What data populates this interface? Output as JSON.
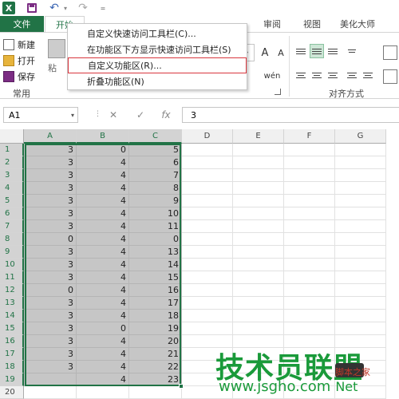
{
  "quick_access": {
    "app_icon": "X",
    "undo_glyph": "↶",
    "redo_glyph": "↷",
    "dropdown_glyph": "▾",
    "customize_glyph": "="
  },
  "tabs": {
    "file": "文件",
    "home": "开始",
    "visible": [
      {
        "label": "审阅"
      },
      {
        "label": "视图"
      },
      {
        "label": "美化大师"
      }
    ]
  },
  "ribbon": {
    "new": "新建",
    "open": "打开",
    "save": "保存",
    "common_group": "常用",
    "paste_label": "粘",
    "alignment_group": "对齐方式",
    "grow_font": "A",
    "shrink_font": "A",
    "phonetic": "wén",
    "font_size_dd": "▾"
  },
  "menu": {
    "items": [
      {
        "label": "自定义快速访问工具栏(C)..."
      },
      {
        "label": "在功能区下方显示快速访问工具栏(S)"
      },
      {
        "label": "自定义功能区(R)..."
      },
      {
        "label": "折叠功能区(N)"
      }
    ]
  },
  "formula_bar": {
    "name_box": "A1",
    "cancel": "✕",
    "confirm": "✓",
    "fx": "fx",
    "value": "3"
  },
  "grid": {
    "columns": [
      "A",
      "B",
      "C",
      "D",
      "E",
      "F",
      "G"
    ],
    "rows": [
      {
        "n": "1",
        "a": "3",
        "b": "0",
        "c": "5"
      },
      {
        "n": "2",
        "a": "3",
        "b": "4",
        "c": "6"
      },
      {
        "n": "3",
        "a": "3",
        "b": "4",
        "c": "7"
      },
      {
        "n": "4",
        "a": "3",
        "b": "4",
        "c": "8"
      },
      {
        "n": "5",
        "a": "3",
        "b": "4",
        "c": "9"
      },
      {
        "n": "6",
        "a": "3",
        "b": "4",
        "c": "10"
      },
      {
        "n": "7",
        "a": "3",
        "b": "4",
        "c": "11"
      },
      {
        "n": "8",
        "a": "0",
        "b": "4",
        "c": "0"
      },
      {
        "n": "9",
        "a": "3",
        "b": "4",
        "c": "13"
      },
      {
        "n": "10",
        "a": "3",
        "b": "4",
        "c": "14"
      },
      {
        "n": "11",
        "a": "3",
        "b": "4",
        "c": "15"
      },
      {
        "n": "12",
        "a": "0",
        "b": "4",
        "c": "16"
      },
      {
        "n": "13",
        "a": "3",
        "b": "4",
        "c": "17"
      },
      {
        "n": "14",
        "a": "3",
        "b": "4",
        "c": "18"
      },
      {
        "n": "15",
        "a": "3",
        "b": "0",
        "c": "19"
      },
      {
        "n": "16",
        "a": "3",
        "b": "4",
        "c": "20"
      },
      {
        "n": "17",
        "a": "3",
        "b": "4",
        "c": "21"
      },
      {
        "n": "18",
        "a": "3",
        "b": "4",
        "c": "22"
      },
      {
        "n": "19",
        "a": "",
        "b": "4",
        "c": "23"
      },
      {
        "n": "20",
        "a": "",
        "b": "",
        "c": ""
      }
    ]
  },
  "watermark": {
    "title": "技术员联盟",
    "url": "www.jsgho.com",
    "suffix": "Net",
    "sub": "脚本之家"
  },
  "colors": {
    "excel_green": "#217346",
    "menu_highlight": "#d9363e",
    "watermark_green": "#1a9a3a"
  }
}
